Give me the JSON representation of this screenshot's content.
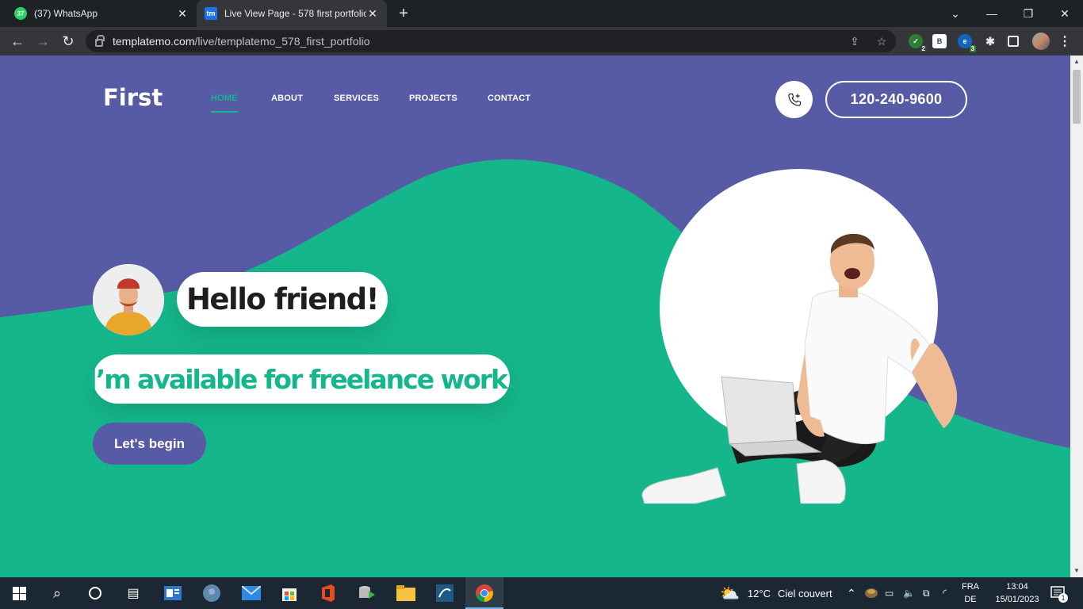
{
  "browser": {
    "tabs": [
      {
        "title": "(37) WhatsApp",
        "favicon_text": "37"
      },
      {
        "title": "Live View Page - 578 first portfolio",
        "favicon_text": "tm"
      }
    ],
    "url_domain": "templatemo.com",
    "url_path": "/live/templatemo_578_first_portfolio",
    "extension_badges": {
      "shield": "2",
      "edge": "3"
    },
    "extension_b_label": "B"
  },
  "site": {
    "logo": "First",
    "nav": [
      "HOME",
      "ABOUT",
      "SERVICES",
      "PROJECTS",
      "CONTACT"
    ],
    "active_nav": "HOME",
    "phone": "120-240-9600",
    "hello": "Hello friend!",
    "tagline": "I’m available for freelance work.",
    "cta": "Let's begin",
    "colors": {
      "purple": "#575aa5",
      "green": "#15b68b",
      "white": "#ffffff"
    }
  },
  "taskbar": {
    "weather_temp": "12°C",
    "weather_text": "Ciel couvert",
    "lang_top": "FRA",
    "lang_bottom": "DE",
    "time": "13:04",
    "date": "15/01/2023",
    "notification_count": "1"
  }
}
